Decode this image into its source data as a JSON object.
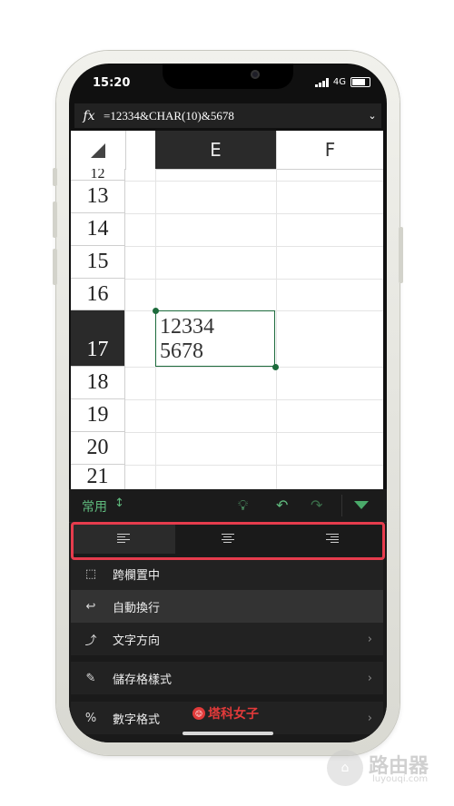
{
  "status": {
    "time": "15:20",
    "network": "4G"
  },
  "formula_bar": {
    "fx": "fx",
    "formula": "=12334&CHAR(10)&5678"
  },
  "sheet": {
    "columns": [
      {
        "label": "E"
      },
      {
        "label": "F"
      }
    ],
    "rows": [
      "12",
      "13",
      "14",
      "15",
      "16",
      "17",
      "18",
      "19",
      "20",
      "21"
    ],
    "selected_row": "17",
    "selected_cell_lines": [
      "12334",
      "5678"
    ]
  },
  "ribbon": {
    "tab_label": "常用",
    "commands": [
      {
        "label": "跨欄置中",
        "icon": "merge-center-icon"
      },
      {
        "label": "自動換行",
        "icon": "wrap-text-icon"
      },
      {
        "label": "文字方向",
        "icon": "text-direction-icon"
      },
      {
        "label": "儲存格樣式",
        "icon": "cell-style-icon"
      },
      {
        "label": "數字格式",
        "icon": "number-format-icon"
      }
    ],
    "highlight_color": "#e63c4d"
  },
  "watermark": {
    "brand": "塔科女子",
    "site": "路由器",
    "url": "luyouqi.com"
  },
  "colors": {
    "accent": "#5fba7d",
    "selection": "#1d6b3c"
  }
}
